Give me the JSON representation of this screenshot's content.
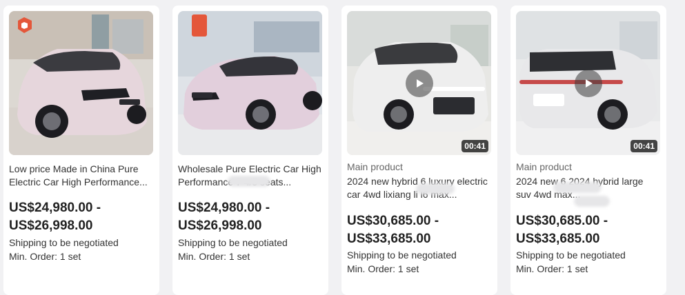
{
  "products": [
    {
      "title": "Low price Made in China Pure Electric Car High Performance...",
      "price_range": "US$24,980.00 - US$26,998.00",
      "shipping": "Shipping to be negotiated",
      "min_order": "Min. Order: 1 set",
      "car_color": "#e6d6dc"
    },
    {
      "title": "Wholesale Pure Electric Car High Performance 7 4/5 seats...",
      "price_range": "US$24,980.00 - US$26,998.00",
      "shipping": "Shipping to be negotiated",
      "min_order": "Min. Order: 1 set",
      "car_color": "#e2cfdc"
    },
    {
      "tag": "Main product",
      "title": "2024 new hybrid 6 luxury electric car 4wd lixiang li l6 max...",
      "price_range": "US$30,685.00 - US$33,685.00",
      "shipping": "Shipping to be negotiated",
      "min_order": "Min. Order: 1 set",
      "video_duration": "00:41",
      "car_color": "#eeeeee"
    },
    {
      "tag": "Main product",
      "title": "2024 new 6 2024 hybrid large suv 4wd max...",
      "price_range": "US$30,685.00 - US$33,685.00",
      "shipping": "Shipping to be negotiated",
      "min_order": "Min. Order: 1 set",
      "video_duration": "00:41",
      "car_color": "#e8e8ea"
    }
  ],
  "colors": {
    "page_bg": "#f1f1f3",
    "card_bg": "#ffffff",
    "text": "#222222",
    "muted": "#666666"
  },
  "icons": {
    "play": "play-icon",
    "badge": "store-badge-icon"
  }
}
